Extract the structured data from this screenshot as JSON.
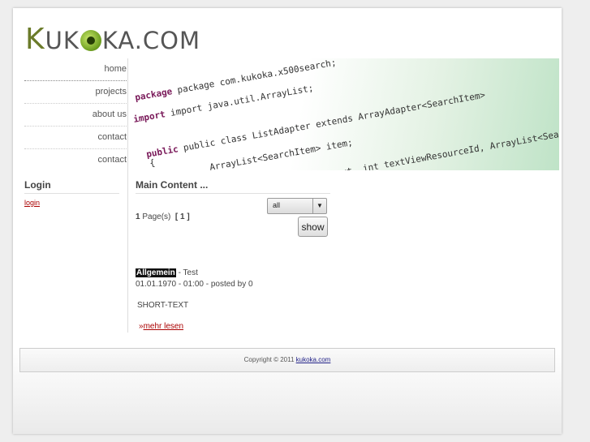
{
  "site": {
    "logo": {
      "k1": "K",
      "mid1": "UK",
      "mid2": "K",
      "rest": "A.COM"
    }
  },
  "nav": {
    "items": [
      {
        "label": "home"
      },
      {
        "label": "projects"
      },
      {
        "label": "about us"
      },
      {
        "label": "contact"
      },
      {
        "label": "contact"
      }
    ]
  },
  "banner": {
    "code_lines": [
      "package com.kukoka.x500search;",
      "import java.util.ArrayList;",
      "public class ListAdapter extends ArrayAdapter<SearchItem>",
      "{",
      "ArrayList<SearchItem> item;",
      "context, int textViewResourceId, ArrayList<Search"
    ]
  },
  "sidebar": {
    "login_title": "Login",
    "login_link": "login"
  },
  "main": {
    "title": "Main Content ...",
    "pager": {
      "count": "1",
      "pages_label": "Page(s)",
      "current": "[ 1 ]"
    },
    "filter": {
      "selected": "all"
    },
    "show_label": "show",
    "post": {
      "category": "Allgemein",
      "title": "- Test",
      "meta": "01.01.1970 - 01:00 - posted by 0",
      "body": "SHORT-TEXT",
      "more_prefix": "»",
      "more_label": "mehr lesen"
    }
  },
  "footer": {
    "copyright": "Copyright © 2011",
    "link": "kukoka.com"
  },
  "colors": {
    "accent_link": "#aa0000",
    "logo_green": "#6b7b2a"
  }
}
